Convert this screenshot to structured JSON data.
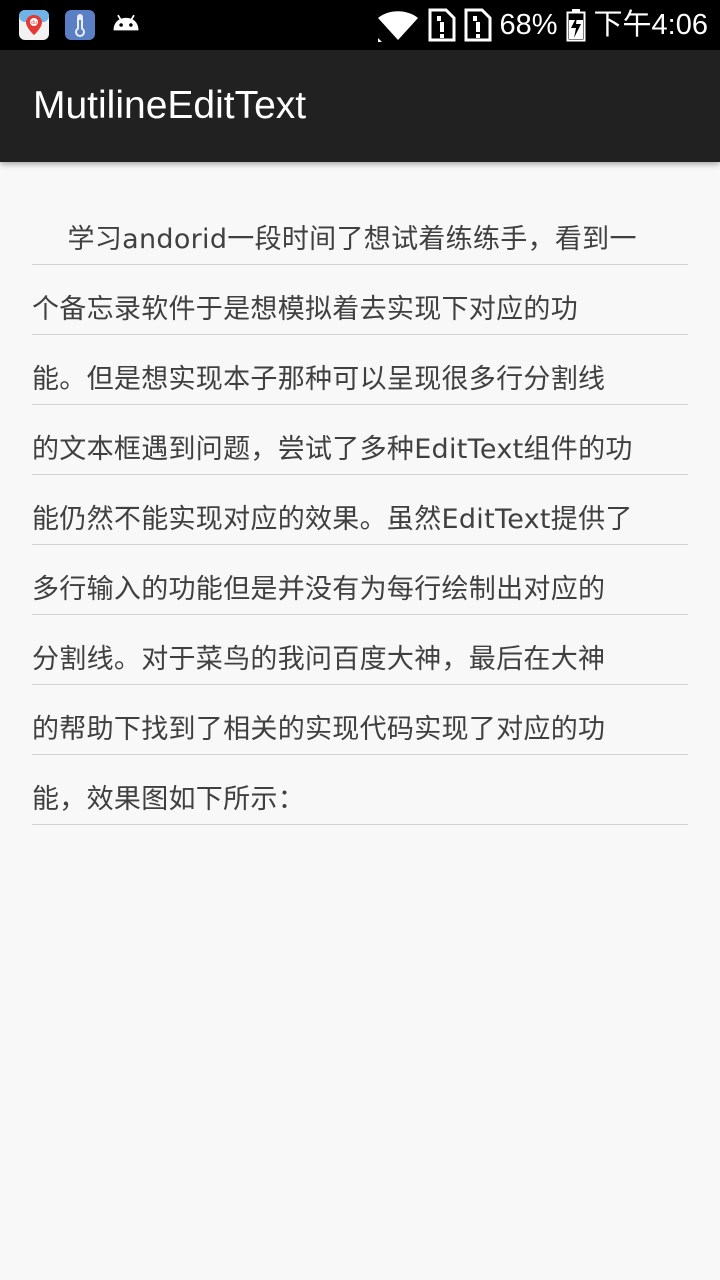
{
  "status_bar": {
    "notification_icons": [
      "baidu-maps-icon",
      "thermometer-app-icon",
      "android-icon"
    ],
    "status_icons": [
      "wifi-icon",
      "sim-alert-icon",
      "sim-alert-icon"
    ],
    "battery_percent": "68%",
    "time": "下午4:06"
  },
  "app_bar": {
    "title": "MutilineEditText"
  },
  "editor": {
    "lines": [
      "    学习andorid一段时间了想试着练练手，看到一",
      "个备忘录软件于是想模拟着去实现下对应的功",
      "能。但是想实现本子那种可以呈现很多行分割线",
      "的文本框遇到问题，尝试了多种EditText组件的功",
      "能仍然不能实现对应的效果。虽然EditText提供了",
      "多行输入的功能但是并没有为每行绘制出对应的",
      "分割线。对于菜鸟的我问百度大神，最后在大神",
      "的帮助下找到了相关的实现代码实现了对应的功",
      "能，效果图如下所示："
    ]
  },
  "colors": {
    "status_bar": "#000000",
    "app_bar": "#212121",
    "background": "#f8f8f8",
    "text": "#404040",
    "divider": "#d4d4d4"
  }
}
